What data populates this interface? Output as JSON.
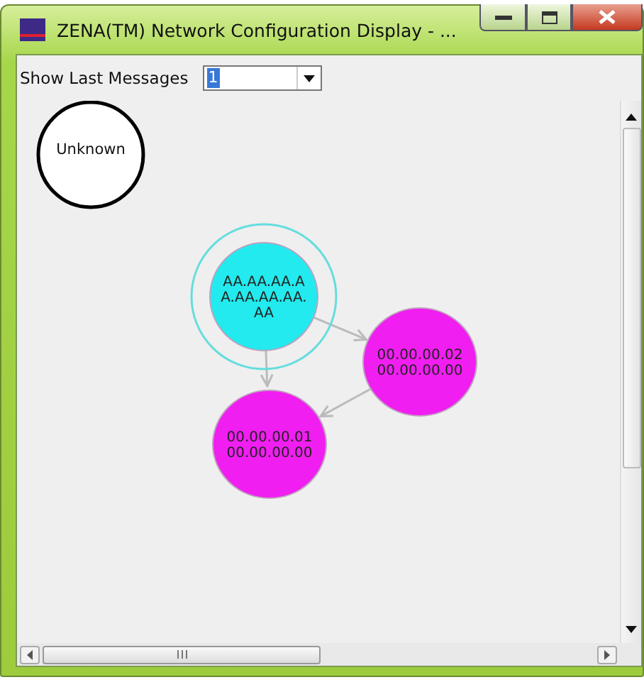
{
  "window": {
    "title": "ZENA(TM) Network Configuration Display - ..."
  },
  "toolbar": {
    "label": "Show Last Messages",
    "combo": {
      "value": "1"
    }
  },
  "graph": {
    "nodes": [
      {
        "kind": "unknown",
        "lines": [
          "Unknown"
        ],
        "selected": false,
        "color": "#ffffff"
      },
      {
        "kind": "device",
        "lines": [
          "AA.AA.AA.A",
          "A.AA.AA.AA.",
          "AA"
        ],
        "selected": true,
        "color": "#22eaee"
      },
      {
        "kind": "device",
        "lines": [
          "00.00.00.02",
          "00.00.00.00"
        ],
        "selected": false,
        "color": "#f01ef0"
      },
      {
        "kind": "device",
        "lines": [
          "00.00.00.01",
          "00.00.00.00"
        ],
        "selected": false,
        "color": "#f01ef0"
      }
    ]
  }
}
